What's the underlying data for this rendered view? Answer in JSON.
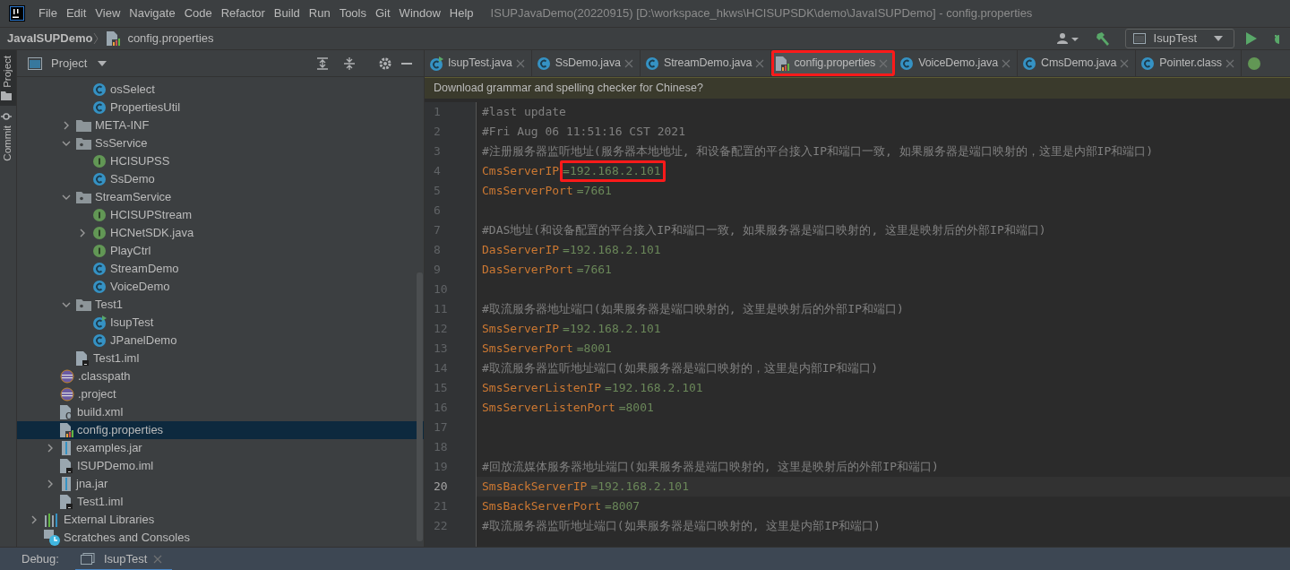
{
  "menu": [
    "File",
    "Edit",
    "View",
    "Navigate",
    "Code",
    "Refactor",
    "Build",
    "Run",
    "Tools",
    "Git",
    "Window",
    "Help"
  ],
  "window": {
    "title": "ISUPJavaDemo(20220915) [D:\\workspace_hkws\\HCISUPSDK\\demo\\JavaISUPDemo] - config.properties"
  },
  "breadcrumb": [
    {
      "label": "JavaISUPDemo",
      "kind": "project"
    },
    {
      "label": "config.properties",
      "kind": "properties"
    }
  ],
  "run_config": {
    "label": "IsupTest"
  },
  "side_strip": [
    {
      "label": "Project",
      "selected": true
    },
    {
      "label": "Commit",
      "selected": false
    }
  ],
  "project_panel": {
    "title": "Project"
  },
  "tree": [
    {
      "children": [
        {
          "children": [
            {
              "children": [
                {
                  "label": "osSelect",
                  "kind": "class"
                },
                {
                  "label": "PropertiesUtil",
                  "kind": "class"
                }
              ]
            },
            {
              "label": "META-INF",
              "kind": "folder",
              "expanded": false
            },
            {
              "label": "SsService",
              "kind": "package",
              "expanded": true,
              "children": [
                {
                  "label": "HCISUPSS",
                  "kind": "interface"
                },
                {
                  "label": "SsDemo",
                  "kind": "class"
                }
              ]
            },
            {
              "label": "StreamService",
              "kind": "package",
              "expanded": true,
              "children": [
                {
                  "label": "HCISUPStream",
                  "kind": "interface"
                },
                {
                  "label": "HCNetSDK.java",
                  "kind": "interface",
                  "expanded": false
                },
                {
                  "label": "PlayCtrl",
                  "kind": "interface"
                },
                {
                  "label": "StreamDemo",
                  "kind": "class"
                },
                {
                  "label": "VoiceDemo",
                  "kind": "class"
                }
              ]
            },
            {
              "label": "Test1",
              "kind": "package",
              "expanded": true,
              "children": [
                {
                  "label": "IsupTest",
                  "kind": "runclass"
                },
                {
                  "label": "JPanelDemo",
                  "kind": "class"
                }
              ]
            },
            {
              "label": "Test1.iml",
              "kind": "module"
            }
          ]
        },
        {
          "label": ".classpath",
          "kind": "eclipse"
        },
        {
          "label": ".project",
          "kind": "eclipse"
        },
        {
          "label": "build.xml",
          "kind": "ant"
        },
        {
          "label": "config.properties",
          "kind": "properties",
          "selected": true
        },
        {
          "label": "examples.jar",
          "kind": "jar",
          "expanded": false
        },
        {
          "label": "ISUPDemo.iml",
          "kind": "module"
        },
        {
          "label": "jna.jar",
          "kind": "jar",
          "expanded": false
        },
        {
          "label": "Test1.iml",
          "kind": "module"
        }
      ]
    },
    {
      "label": "External Libraries",
      "kind": "library",
      "expanded": false
    },
    {
      "label": "Scratches and Consoles",
      "kind": "scratch"
    }
  ],
  "tabs": [
    {
      "label": "IsupTest.java",
      "kind": "runclass",
      "selected": false,
      "highlighted": false
    },
    {
      "label": "SsDemo.java",
      "kind": "class",
      "selected": false,
      "highlighted": false
    },
    {
      "label": "StreamDemo.java",
      "kind": "class",
      "selected": false,
      "highlighted": false
    },
    {
      "label": "config.properties",
      "kind": "properties",
      "selected": true,
      "highlighted": true
    },
    {
      "label": "VoiceDemo.java",
      "kind": "class",
      "selected": false,
      "highlighted": false
    },
    {
      "label": "CmsDemo.java",
      "kind": "class",
      "selected": false,
      "highlighted": false
    },
    {
      "label": "Pointer.class",
      "kind": "class",
      "selected": false,
      "highlighted": false
    }
  ],
  "notification": "Download grammar and spelling checker for Chinese?",
  "lines": [
    {
      "number": "1",
      "kind": "comment",
      "text": "#last update"
    },
    {
      "number": "2",
      "kind": "comment",
      "text": "#Fri Aug 06 11:51:16 CST 2021"
    },
    {
      "number": "3",
      "kind": "comment",
      "text": "#注册服务器监听地址(服务器本地地址, 和设备配置的平台接入IP和端口一致, 如果服务器是端口映射的，这里是内部IP和端口)"
    },
    {
      "number": "4",
      "kind": "property",
      "key": "CmsServerIP",
      "separator": "=",
      "value": "192.168.2.101",
      "highlighted": true
    },
    {
      "number": "5",
      "kind": "property",
      "key": "CmsServerPort",
      "separator": "=",
      "value": "7661"
    },
    {
      "number": "6",
      "kind": "blank"
    },
    {
      "number": "7",
      "kind": "comment",
      "text": "#DAS地址(和设备配置的平台接入IP和端口一致, 如果服务器是端口映射的, 这里是映射后的外部IP和端口)"
    },
    {
      "number": "8",
      "kind": "property",
      "key": "DasServerIP",
      "separator": "=",
      "value": "192.168.2.101"
    },
    {
      "number": "9",
      "kind": "property",
      "key": "DasServerPort",
      "separator": "=",
      "value": "7661"
    },
    {
      "number": "10",
      "kind": "blank"
    },
    {
      "number": "11",
      "kind": "comment",
      "text": "#取流服务器地址端口(如果服务器是端口映射的, 这里是映射后的外部IP和端口)"
    },
    {
      "number": "12",
      "kind": "property",
      "key": "SmsServerIP",
      "separator": "=",
      "value": "192.168.2.101"
    },
    {
      "number": "13",
      "kind": "property",
      "key": "SmsServerPort",
      "separator": "=",
      "value": "8001"
    },
    {
      "number": "14",
      "kind": "comment",
      "text": "#取流服务器监听地址端口(如果服务器是端口映射的，这里是内部IP和端口)"
    },
    {
      "number": "15",
      "kind": "property",
      "key": "SmsServerListenIP",
      "separator": "=",
      "value": "192.168.2.101"
    },
    {
      "number": "16",
      "kind": "property",
      "key": "SmsServerListenPort",
      "separator": "=",
      "value": "8001"
    },
    {
      "number": "17",
      "kind": "blank"
    },
    {
      "number": "18",
      "kind": "blank"
    },
    {
      "number": "19",
      "kind": "comment",
      "text": "#回放流媒体服务器地址端口(如果服务器是端口映射的, 这里是映射后的外部IP和端口)"
    },
    {
      "number": "20",
      "kind": "property",
      "key": "SmsBackServerIP",
      "separator": "=",
      "value": "192.168.2.101",
      "current": true
    },
    {
      "number": "21",
      "kind": "property",
      "key": "SmsBackServerPort",
      "separator": "=",
      "value": "8007"
    },
    {
      "number": "22",
      "kind": "comment",
      "text": "#取流服务器监听地址端口(如果服务器是端口映射的, 这里是内部IP和端口)"
    }
  ],
  "debug_bar": {
    "label": "Debug:",
    "tabs": [
      {
        "label": "IsupTest",
        "selected": true
      }
    ]
  }
}
